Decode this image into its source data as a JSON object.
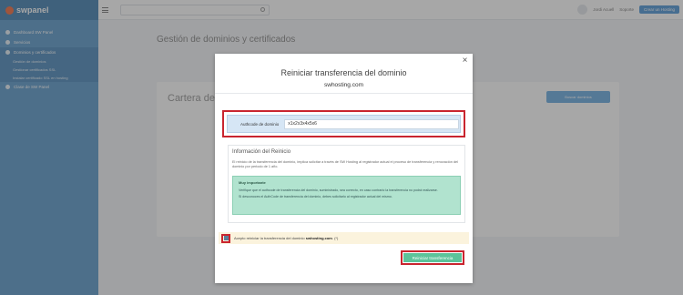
{
  "app": {
    "logo": "swpanel"
  },
  "sidebar": {
    "items": [
      {
        "label": "Dashboard SW Panel"
      },
      {
        "label": "Servicios"
      },
      {
        "label": "Dominios y certificados"
      },
      {
        "label": "Clase de SW Panel"
      }
    ],
    "subitems": [
      {
        "label": "Gestión de dominios"
      },
      {
        "label": "Gestionar certificados SSL"
      },
      {
        "label": "Instalar certificado SSL en hosting"
      }
    ]
  },
  "topbar": {
    "search_placeholder": "",
    "user": "Jordi Acuell",
    "support": "Soporte",
    "button": "Crear un Hosting"
  },
  "background": {
    "page_title": "Gestión de dominios y certificados",
    "card_title": "Cartera de",
    "card_button": "Buscar dominios"
  },
  "modal": {
    "title": "Reiniciar transferencia del dominio",
    "domain": "swhosting.com",
    "authcode_label": "Authcode de dominio",
    "authcode_value": "x1x2x3x4x5x6",
    "info_title": "Información del Reinicio",
    "info_text": "El reinicio de la transferencia del dominio, implica solicitar a través de SW Hosting al registrador actual el proceso de transferencia y renovación del dominio por periodo de 1 año.",
    "important_title": "Muy importante",
    "important_text_1": "Verifique que el authcode de transferencia del dominio, suministrado, sea correcto, en caso contrario la transferencia no podrá realizarse.",
    "important_text_2": "Si desconoces el AuthCode de transferencia del dominio, debes solicitarlo al registrador actual del mismo.",
    "accept_text_prefix": "Acepto reiniciar la transferencia del dominio",
    "accept_domain": "swhosting.com",
    "accept_suffix": ". (*)",
    "submit": "Reiniciar transferencia"
  },
  "colors": {
    "sidebar": "#4a8ec4",
    "highlight": "#c9252f",
    "success": "#5cc39a",
    "important_bg": "#b1e3cf"
  }
}
